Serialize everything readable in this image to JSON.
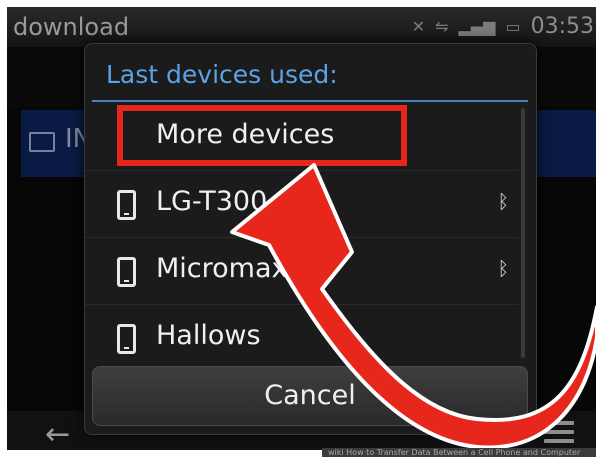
{
  "statusbar": {
    "app_title": "download",
    "clock": "03:53",
    "icons": [
      "network-off-icon",
      "usb-icon",
      "signal-icon",
      "battery-icon"
    ]
  },
  "background": {
    "row_text": "IN"
  },
  "dialog": {
    "title": "Last devices used:",
    "items": [
      {
        "label": "More devices",
        "icon": "none",
        "bluetooth": false
      },
      {
        "label": "LG-T300",
        "icon": "phone-icon",
        "bluetooth": true
      },
      {
        "label": "Micromax A",
        "icon": "phone-icon",
        "bluetooth": true
      },
      {
        "label": "Hallows",
        "icon": "phone-icon",
        "bluetooth": false
      }
    ],
    "cancel_label": "Cancel"
  },
  "colors": {
    "title_blue": "#5aa3e6",
    "annotation_red": "#e8271c",
    "selected_row": "#0f2a6b"
  },
  "watermark": "wiki How to Transfer Data Between a Cell Phone and Computer"
}
